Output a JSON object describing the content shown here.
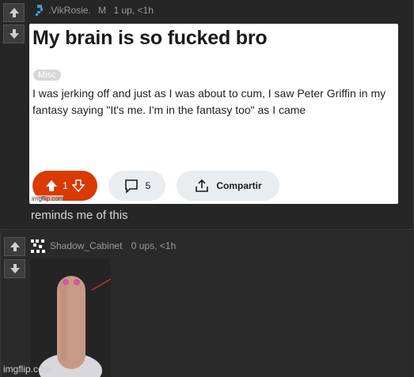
{
  "comments": [
    {
      "user": ".VikRosie.",
      "badge": "M",
      "stats": "1 up, <1h",
      "post": {
        "title": "My brain is so fucked bro",
        "flair": "Misc",
        "body": "I was jerking off and just as I was about to cum, I saw Peter Griffin in my fantasy saying \"It's me. I'm in the fantasy too\" as I came",
        "vote_count": "1",
        "comment_count": "5",
        "share_label": "Compartir",
        "image_watermark": "imgflip.com"
      },
      "text": "reminds me of this"
    },
    {
      "user": "Shadow_Cabinet",
      "stats": "0 ups, <1h"
    }
  ],
  "watermark": "imgflip.com",
  "colors": {
    "page_bg": "#232323",
    "vote_pill": "#d93a00",
    "pill_bg": "#eaedef"
  }
}
